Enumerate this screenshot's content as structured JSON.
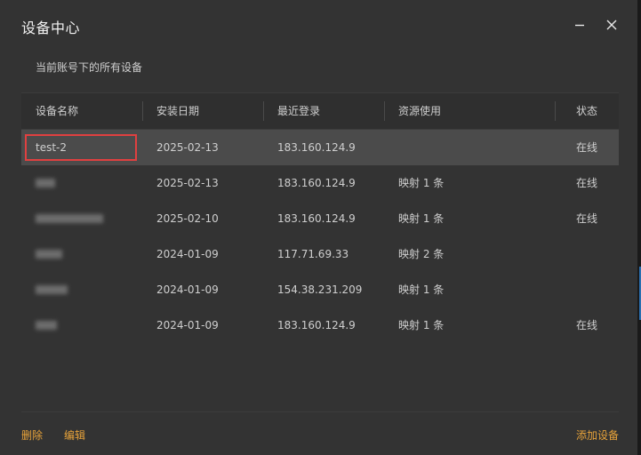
{
  "window": {
    "title": "设备中心",
    "subtitle": "当前账号下的所有设备"
  },
  "table": {
    "headers": [
      "设备名称",
      "安装日期",
      "最近登录",
      "资源使用",
      "状态"
    ],
    "rows": [
      {
        "name": "test-2",
        "date": "2025-02-13",
        "login": "183.160.124.9",
        "usage": "",
        "status": "在线"
      },
      {
        "name": "",
        "date": "2025-02-13",
        "login": "183.160.124.9",
        "usage": "映射 1 条",
        "status": "在线"
      },
      {
        "name": "",
        "date": "2025-02-10",
        "login": "183.160.124.9",
        "usage": "映射 1 条",
        "status": "在线"
      },
      {
        "name": "",
        "date": "2024-01-09",
        "login": "117.71.69.33",
        "usage": "映射 2 条",
        "status": ""
      },
      {
        "name": "",
        "date": "2024-01-09",
        "login": "154.38.231.209",
        "usage": "映射 1 条",
        "status": ""
      },
      {
        "name": "",
        "date": "2024-01-09",
        "login": "183.160.124.9",
        "usage": "映射 1 条",
        "status": "在线"
      }
    ]
  },
  "footer": {
    "delete_label": "删除",
    "edit_label": "编辑",
    "add_label": "添加设备"
  },
  "colors": {
    "accent": "#e8a33a",
    "highlight_border": "#e04040",
    "selected_row": "#4b4b4b",
    "background": "#333333"
  }
}
